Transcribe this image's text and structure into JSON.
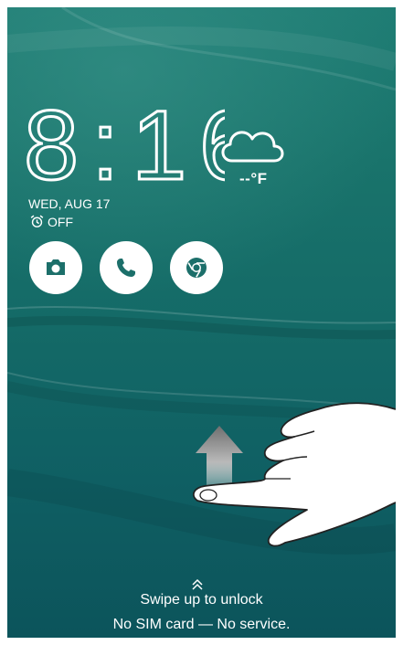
{
  "clock": {
    "time": "8:16"
  },
  "weather": {
    "temperature": "--°F",
    "icon": "cloud-icon"
  },
  "date": "WED, AUG 17",
  "alarm": {
    "status": "OFF",
    "icon": "alarm-clock-icon"
  },
  "shortcuts": [
    {
      "name": "Camera",
      "icon": "camera-icon"
    },
    {
      "name": "Phone",
      "icon": "phone-icon"
    },
    {
      "name": "Chrome",
      "icon": "chrome-icon"
    }
  ],
  "unlock_hint": "Swipe up to unlock",
  "sim_status": "No SIM card — No service.",
  "colors": {
    "background": "#146a67",
    "foreground": "#ffffff"
  }
}
